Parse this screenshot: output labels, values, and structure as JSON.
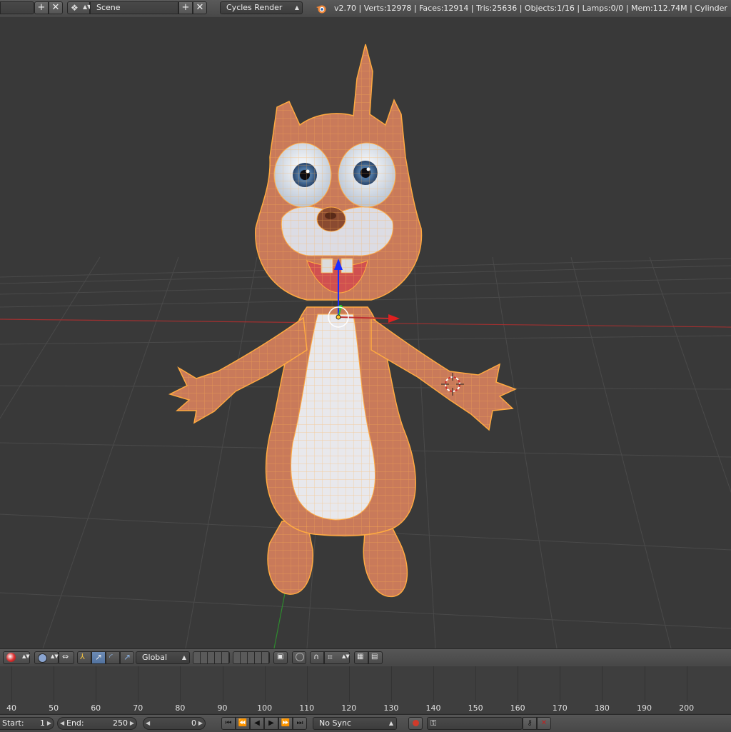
{
  "info_header": {
    "scene_label": "Scene",
    "renderer": "Cycles Render",
    "version": "v2.70",
    "stats": "v2.70 | Verts:12978 | Faces:12914 | Tris:25636 | Objects:1/16 | Lamps:0/0 | Mem:112.74M | Cylinder"
  },
  "view3d_header": {
    "orientation": "Global"
  },
  "timeline": {
    "ruler_labels": [
      "40",
      "50",
      "60",
      "70",
      "80",
      "90",
      "100",
      "110",
      "120",
      "130",
      "140",
      "150",
      "160",
      "170",
      "180",
      "190",
      "200"
    ],
    "start_label": "Start:",
    "start_value": "1",
    "end_label": "End:",
    "end_value": "250",
    "current_frame": "0",
    "sync_mode": "No Sync"
  },
  "colors": {
    "viewport_bg": "#393939",
    "mesh_fur": "#c97a5a",
    "mesh_wire": "#ffaa40",
    "x_axis": "#b03030",
    "y_axis": "#3a9a3a",
    "z_axis": "#2040ff"
  }
}
